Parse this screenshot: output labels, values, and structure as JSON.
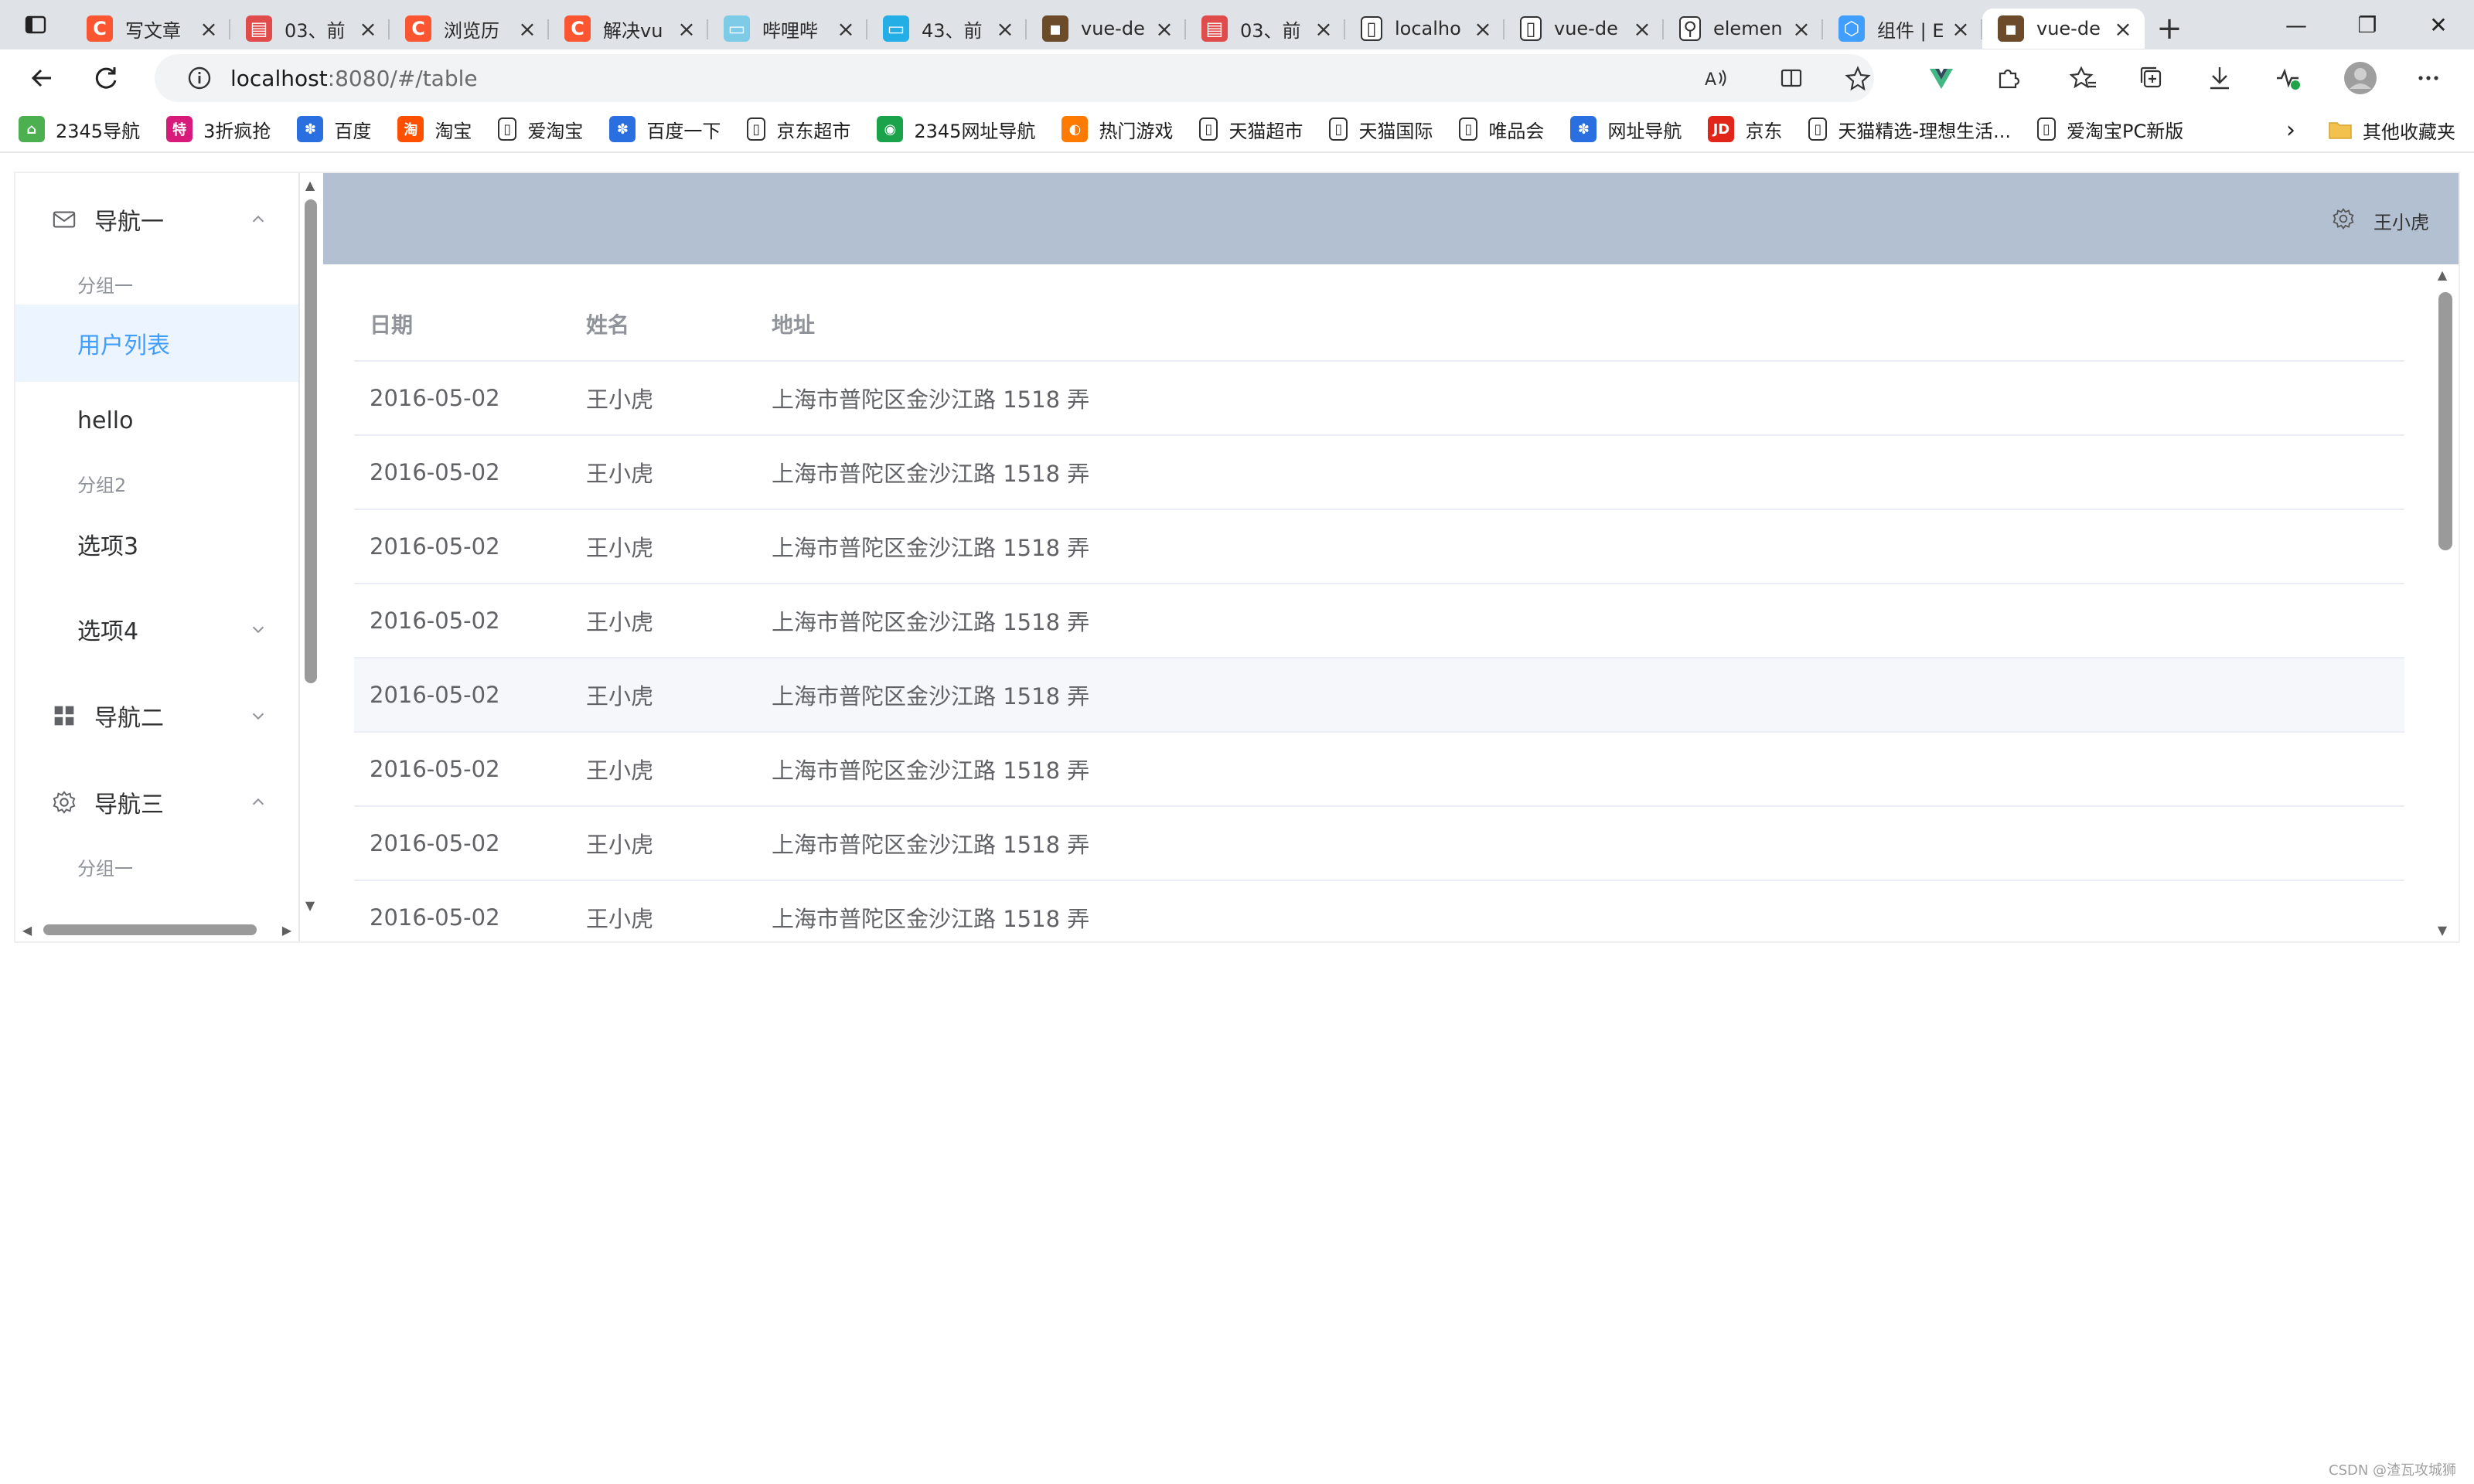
{
  "browser": {
    "tabs": [
      {
        "title": "写文章",
        "favicon": "csdn-icon",
        "color": "#fc5531",
        "glyph": "C"
      },
      {
        "title": "03、前",
        "favicon": "pdf-icon",
        "color": "#e04b4b",
        "glyph": "▤"
      },
      {
        "title": "浏览历",
        "favicon": "csdn-icon",
        "color": "#fc5531",
        "glyph": "C"
      },
      {
        "title": "解决vu",
        "favicon": "csdn-icon",
        "color": "#fc5531",
        "glyph": "C"
      },
      {
        "title": "哔哩哔",
        "favicon": "bilibili-icon",
        "color": "#7ecbe8",
        "glyph": "▭"
      },
      {
        "title": "43、前",
        "favicon": "bilibili-icon",
        "color": "#23aee5",
        "glyph": "▭"
      },
      {
        "title": "vue-de",
        "favicon": "avatar-icon",
        "color": "#6b4b2a",
        "glyph": "▪"
      },
      {
        "title": "03、前",
        "favicon": "pdf-icon",
        "color": "#e04b4b",
        "glyph": "▤"
      },
      {
        "title": "localho",
        "favicon": "page-icon",
        "color": "#ffffff",
        "glyph": "▯"
      },
      {
        "title": "vue-de",
        "favicon": "page-icon",
        "color": "#ffffff",
        "glyph": "▯"
      },
      {
        "title": "elemen",
        "favicon": "search-icon",
        "color": "#ffffff",
        "glyph": "⚲"
      },
      {
        "title": "组件 | E",
        "favicon": "element-icon",
        "color": "#409eff",
        "glyph": "⬡"
      },
      {
        "title": "vue-de",
        "favicon": "avatar-icon",
        "color": "#6b4b2a",
        "glyph": "▪"
      }
    ],
    "url_host": "localhost",
    "url_rest": ":8080/#/table",
    "bookmarks": [
      {
        "label": "2345导航",
        "icon": "2345-icon",
        "color": "#4caf50",
        "glyph": "⌂"
      },
      {
        "label": "3折疯抢",
        "icon": "sale-icon",
        "color": "#d81b7a",
        "glyph": "特"
      },
      {
        "label": "百度",
        "icon": "baidu-icon",
        "color": "#2a6fe0",
        "glyph": "✽"
      },
      {
        "label": "淘宝",
        "icon": "taobao-icon",
        "color": "#ff5000",
        "glyph": "淘"
      },
      {
        "label": "爱淘宝",
        "icon": "page-icon",
        "color": "#ffffff",
        "glyph": "▯"
      },
      {
        "label": "百度一下",
        "icon": "baidu-icon",
        "color": "#2a6fe0",
        "glyph": "✽"
      },
      {
        "label": "京东超市",
        "icon": "page-icon",
        "color": "#ffffff",
        "glyph": "▯"
      },
      {
        "label": "2345网址导航",
        "icon": "2345-icon",
        "color": "#1aa34a",
        "glyph": "◉"
      },
      {
        "label": "热门游戏",
        "icon": "game-icon",
        "color": "#ff7a00",
        "glyph": "◐"
      },
      {
        "label": "天猫超市",
        "icon": "page-icon",
        "color": "#ffffff",
        "glyph": "▯"
      },
      {
        "label": "天猫国际",
        "icon": "page-icon",
        "color": "#ffffff",
        "glyph": "▯"
      },
      {
        "label": "唯品会",
        "icon": "page-icon",
        "color": "#ffffff",
        "glyph": "▯"
      },
      {
        "label": "网址导航",
        "icon": "baidu-icon",
        "color": "#2a6fe0",
        "glyph": "✽"
      },
      {
        "label": "京东",
        "icon": "jd-icon",
        "color": "#e1251b",
        "glyph": "JD"
      },
      {
        "label": "天猫精选-理想生活...",
        "icon": "page-icon",
        "color": "#ffffff",
        "glyph": "▯"
      },
      {
        "label": "爱淘宝PC新版",
        "icon": "page-icon",
        "color": "#ffffff",
        "glyph": "▯"
      }
    ],
    "other_bookmarks": "其他收藏夹"
  },
  "sidebar": {
    "nav1": "导航一",
    "group1": "分组一",
    "item_user_list": "用户列表",
    "item_hello": "hello",
    "group2": "分组2",
    "item_option3": "选项3",
    "item_option4": "选项4",
    "nav2": "导航二",
    "nav3": "导航三",
    "group3": "分组一"
  },
  "header": {
    "username": "王小虎"
  },
  "table": {
    "columns": [
      "日期",
      "姓名",
      "地址"
    ],
    "rows": [
      {
        "date": "2016-05-02",
        "name": "王小虎",
        "address": "上海市普陀区金沙江路 1518 弄"
      },
      {
        "date": "2016-05-02",
        "name": "王小虎",
        "address": "上海市普陀区金沙江路 1518 弄"
      },
      {
        "date": "2016-05-02",
        "name": "王小虎",
        "address": "上海市普陀区金沙江路 1518 弄"
      },
      {
        "date": "2016-05-02",
        "name": "王小虎",
        "address": "上海市普陀区金沙江路 1518 弄"
      },
      {
        "date": "2016-05-02",
        "name": "王小虎",
        "address": "上海市普陀区金沙江路 1518 弄"
      },
      {
        "date": "2016-05-02",
        "name": "王小虎",
        "address": "上海市普陀区金沙江路 1518 弄"
      },
      {
        "date": "2016-05-02",
        "name": "王小虎",
        "address": "上海市普陀区金沙江路 1518 弄"
      },
      {
        "date": "2016-05-02",
        "name": "王小虎",
        "address": "上海市普陀区金沙江路 1518 弄"
      }
    ]
  },
  "colors": {
    "header_bg": "#b3c0d1",
    "active_menu_bg": "#ecf5ff",
    "active_menu_text": "#409eff",
    "hover_row_bg": "#f5f7fa"
  },
  "watermark": "CSDN @渣瓦攻城狮"
}
